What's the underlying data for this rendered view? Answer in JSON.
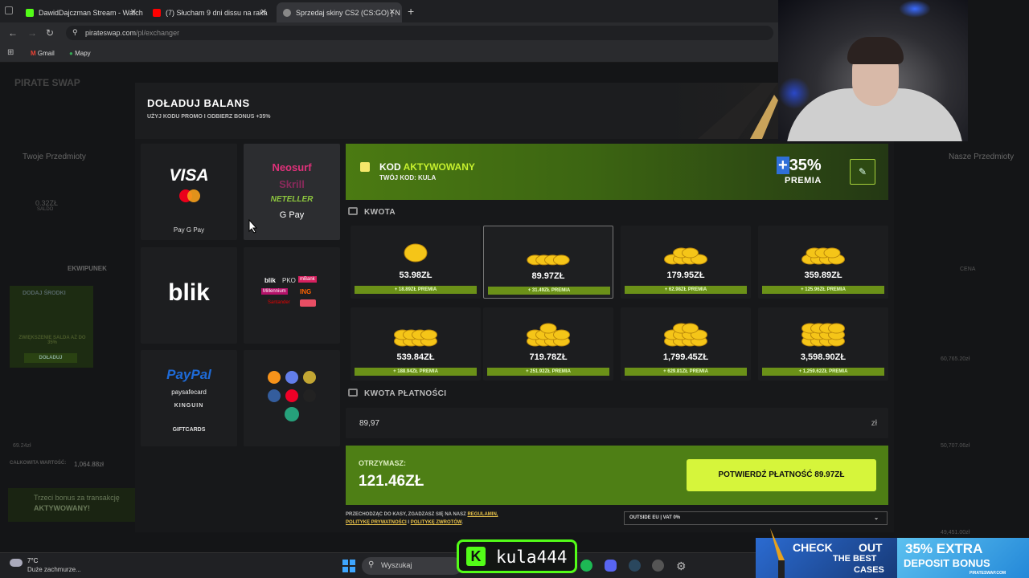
{
  "browser": {
    "tabs": [
      {
        "label": "DawidDajczman Stream - Watch",
        "color": "#53fc18"
      },
      {
        "label": "(7) Słucham 9 dni dissu na raka",
        "color": "#ff0000"
      },
      {
        "label": "Sprzedaj skiny CS2 (CS:GO) | N",
        "color": "#dddddd"
      }
    ],
    "new_tab": "+",
    "url_host": "pirateswap.com",
    "url_path": "/pl/exchanger",
    "bookmarks": [
      "Gmail",
      "Mapy"
    ]
  },
  "site_bg": {
    "logo": "PIRATE SWAP",
    "left_panel": "Twoje Przedmioty",
    "right_panel": "Nasze Przedmioty",
    "saldo_value": "0.32ZŁ",
    "saldo_label": "SALDO",
    "tab_inventory": "EKWIPUNEK",
    "sort_label": "CENA",
    "add_funds": "DODAJ ŚRODKI",
    "bonus_text": "ZWIĘKSZENIE SALDA AŻ DO 35%",
    "add_btn": "DOŁADUJ",
    "total_label": "CAŁKOWITA WARTOŚĆ:",
    "total_value": "1,064.88zł",
    "bonus_banner_1": "Trzeci bonus za transakcję",
    "bonus_banner_2": "AKTYWOWANY!",
    "item_price_left": "69.24zł",
    "item_price_right_1": "60,765.20zł",
    "item_price_right_2": "50,707.06zł",
    "item_price_right_3": "49,451.00zł"
  },
  "modal": {
    "title": "DOŁADUJ BALANS",
    "subtitle": "UŻYJ KODU PROMO I ODBIERZ BONUS +35%",
    "methods": {
      "card": {
        "name": "VISA",
        "sub": " Pay  G Pay"
      },
      "ewallet": {
        "neosurf": "Neosurf",
        "skrill": "Skrill",
        "neteller": "NETELLER",
        "gpay": "G Pay"
      },
      "blik": {
        "name": "blik"
      },
      "banks": {
        "blik": "blik",
        "pko": "PKO",
        "mbank": "mBank",
        "millennium": "Millennium",
        "ing": "ING",
        "santander": "Santander"
      },
      "paypal": {
        "name": "PayPal",
        "paysafe": "paysafecard",
        "kinguin": "KINGUIN",
        "label": "GIFTCARDS"
      },
      "crypto": {
        "name": "crypto"
      }
    },
    "promo": {
      "title_a": "KOD",
      "title_b": "AKTYWOWANY",
      "code_label": "TWÓJ KOD: KULA",
      "plus": "+",
      "percent": "35%",
      "premia": "PREMIA"
    },
    "amount_label": "KWOTA",
    "amounts": [
      {
        "price": "53.98ZŁ",
        "bonus": "+ 18.89ZŁ PREMIA"
      },
      {
        "price": "89.97ZŁ",
        "bonus": "+ 31.49ZŁ PREMIA"
      },
      {
        "price": "179.95ZŁ",
        "bonus": "+ 62.98ZŁ PREMIA"
      },
      {
        "price": "359.89ZŁ",
        "bonus": "+ 125.96ZŁ PREMIA"
      },
      {
        "price": "539.84ZŁ",
        "bonus": "+ 188.94ZŁ PREMIA"
      },
      {
        "price": "719.78ZŁ",
        "bonus": "+ 251.92ZŁ PREMIA"
      },
      {
        "price": "1,799.45ZŁ",
        "bonus": "+ 629.81ZŁ PREMIA"
      },
      {
        "price": "3,598.90ZŁ",
        "bonus": "+ 1,259.62ZŁ PREMIA"
      }
    ],
    "payment_label": "KWOTA PŁATNOŚCI",
    "payment_value": "89,97",
    "payment_currency": "zł",
    "receive_label": "OTRZYMASZ:",
    "receive_amount": "121.46ZŁ",
    "confirm": "POTWIERDŹ PŁATNOŚĆ 89.97ZŁ",
    "legal_a": "PRZECHODZĄC DO KASY, ZGADZASZ SIĘ NA NASZ ",
    "legal_link1": "REGULAMIN,",
    "legal_link2": "POLITYKĘ PRYWATNOŚCI",
    "legal_sep": " I ",
    "legal_link3": "POLITYKĘ ZWROTÓW",
    "legal_end": ".",
    "vat": "OUTSIDE EU | VAT 0%"
  },
  "taskbar": {
    "temp": "7°C",
    "weather": "Duże zachmurze...",
    "search": "Wyszukaj"
  },
  "overlays": {
    "kick_handle": "kula444",
    "kick_k": "K",
    "ad_check": "CHECK",
    "ad_out": "OUT",
    "ad_the_best": "THE BEST",
    "ad_cases": "CASES",
    "ad_extra": "35% EXTRA",
    "ad_bonus": "DEPOSIT BONUS",
    "ad_site": "PIRATESWAP.COM"
  }
}
